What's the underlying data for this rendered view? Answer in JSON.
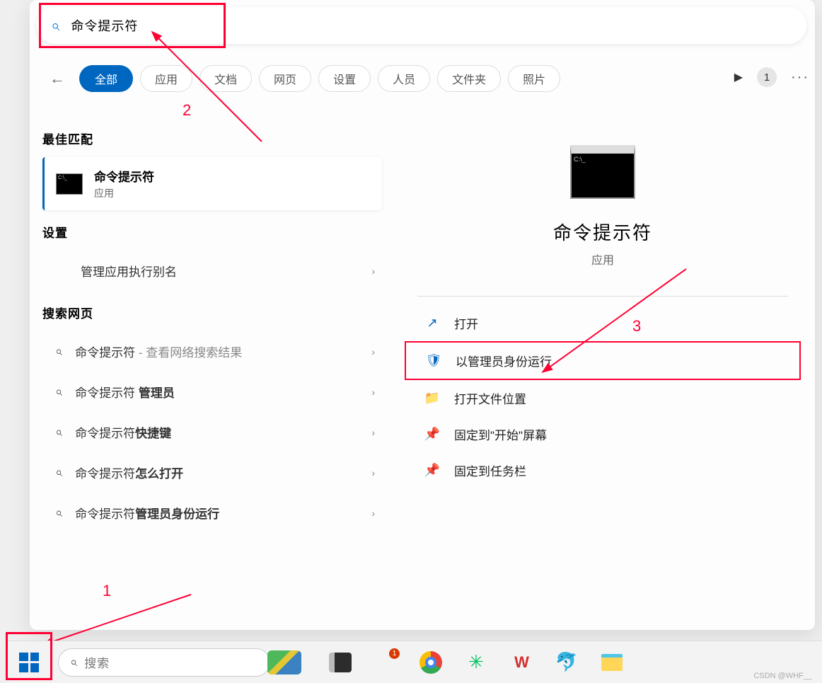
{
  "search": {
    "value": "命令提示符"
  },
  "tabs": {
    "all": "全部",
    "apps": "应用",
    "docs": "文档",
    "web": "网页",
    "settings": "设置",
    "people": "人员",
    "folders": "文件夹",
    "photos": "照片"
  },
  "top_right": {
    "badge": "1",
    "more": "···"
  },
  "sections": {
    "best_match": "最佳匹配",
    "settings": "设置",
    "web": "搜索网页"
  },
  "best_match": {
    "title": "命令提示符",
    "subtitle": "应用"
  },
  "settings_item": {
    "text": "管理应用执行别名"
  },
  "web_items": [
    {
      "prefix": "命令提示符",
      "suffix": " - 查看网络搜索结果",
      "bold": ""
    },
    {
      "prefix": "命令提示符 ",
      "bold": "管理员",
      "suffix": ""
    },
    {
      "prefix": "命令提示符",
      "bold": "快捷键",
      "suffix": ""
    },
    {
      "prefix": "命令提示符",
      "bold": "怎么打开",
      "suffix": ""
    },
    {
      "prefix": "命令提示符",
      "bold": "管理员身份运行",
      "suffix": ""
    }
  ],
  "detail": {
    "title": "命令提示符",
    "subtitle": "应用"
  },
  "actions": {
    "open": "打开",
    "run_admin": "以管理员身份运行",
    "open_location": "打开文件位置",
    "pin_start": "固定到\"开始\"屏幕",
    "pin_taskbar": "固定到任务栏"
  },
  "annotations": {
    "a1": "1",
    "a2": "2",
    "a3": "3"
  },
  "taskbar": {
    "search_placeholder": "搜索",
    "ff_badge": "1",
    "wps": "W"
  },
  "watermark": "CSDN @WHF__"
}
